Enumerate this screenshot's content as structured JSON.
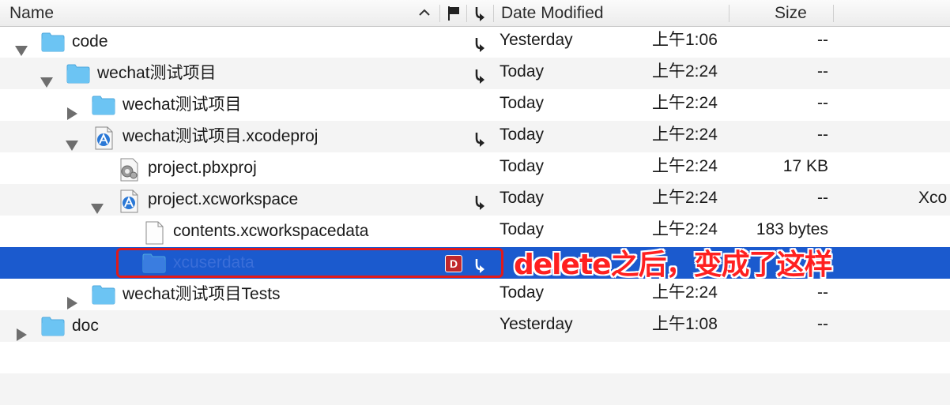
{
  "header": {
    "name": "Name",
    "date_modified": "Date Modified",
    "size": "Size"
  },
  "rows": [
    {
      "name": "code",
      "icon": "folder-icon",
      "disclosure": "expanded",
      "indent": 0,
      "scm": "arrow",
      "date": "Yesterday",
      "time": "上午1:06",
      "size": "--"
    },
    {
      "name": "wechat测试项目",
      "icon": "folder-icon",
      "disclosure": "expanded",
      "indent": 1,
      "scm": "arrow",
      "date": "Today",
      "time": "上午2:24",
      "size": "--"
    },
    {
      "name": "wechat测试项目",
      "icon": "folder-icon",
      "disclosure": "collapsed",
      "indent": 2,
      "scm": "",
      "date": "Today",
      "time": "上午2:24",
      "size": "--"
    },
    {
      "name": "wechat测试项目.xcodeproj",
      "icon": "xcodeproj-icon",
      "disclosure": "expanded",
      "indent": 2,
      "scm": "arrow",
      "date": "Today",
      "time": "上午2:24",
      "size": "--"
    },
    {
      "name": "project.pbxproj",
      "icon": "pbxproj-file-icon",
      "disclosure": "none",
      "indent": 3,
      "scm": "",
      "date": "Today",
      "time": "上午2:24",
      "size": "17 KB"
    },
    {
      "name": "project.xcworkspace",
      "icon": "xcworkspace-icon",
      "disclosure": "expanded",
      "indent": 3,
      "scm": "arrow",
      "date": "Today",
      "time": "上午2:24",
      "size": "--",
      "kind": "Xco"
    },
    {
      "name": "contents.xcworkspacedata",
      "icon": "document-icon",
      "disclosure": "none",
      "indent": 4,
      "scm": "",
      "date": "Today",
      "time": "上午2:24",
      "size": "183 bytes"
    },
    {
      "name": "xcuserdata",
      "icon": "folder-icon",
      "disclosure": "none",
      "indent": 4,
      "scm": "arrow",
      "badge": "D",
      "selected": true,
      "date": "",
      "time": "",
      "size": ""
    },
    {
      "name": "wechat测试项目Tests",
      "icon": "folder-icon",
      "disclosure": "collapsed",
      "indent": 2,
      "scm": "",
      "date": "Today",
      "time": "上午2:24",
      "size": "--"
    },
    {
      "name": "doc",
      "icon": "folder-icon",
      "disclosure": "collapsed",
      "indent": 0,
      "scm": "",
      "date": "Yesterday",
      "time": "上午1:08",
      "size": "--"
    }
  ],
  "annotation": "delete之后，变成了这样",
  "colors": {
    "selection": "#1b5ace",
    "annotation": "#ff2020",
    "folder": "#6cc4f3"
  }
}
